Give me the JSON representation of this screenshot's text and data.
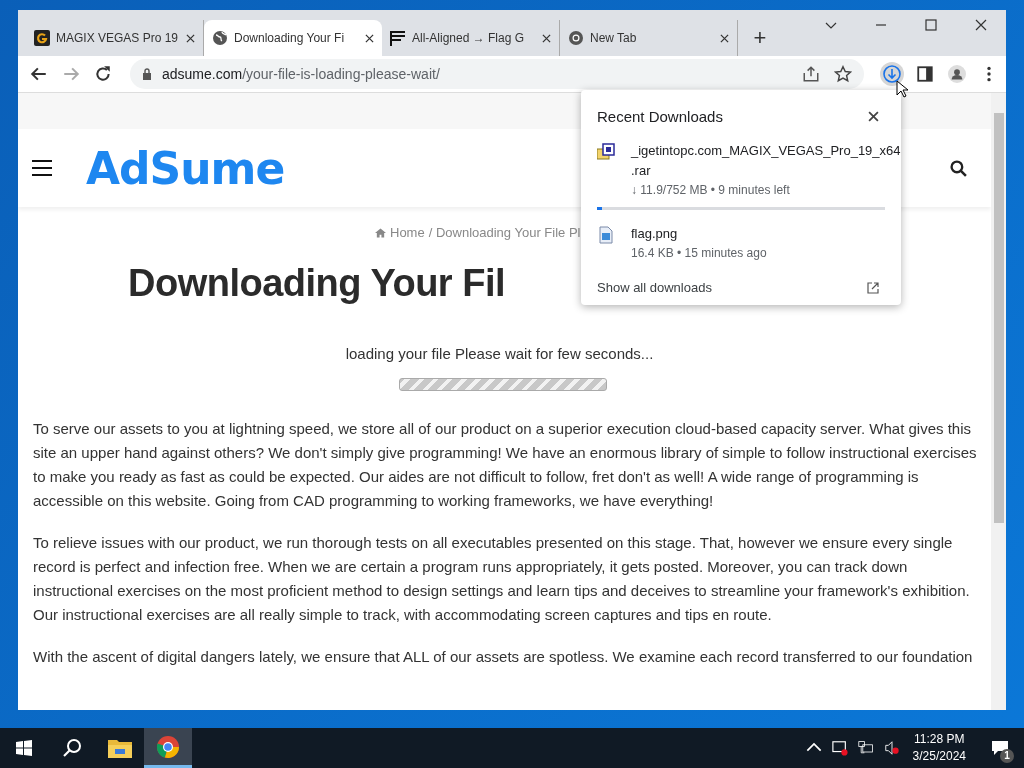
{
  "browser": {
    "tabs": [
      {
        "title": "MAGIX VEGAS Pro 19",
        "selected": false
      },
      {
        "title": "Downloading Your Fi",
        "selected": true
      },
      {
        "title": "All-Aligned → Flag G",
        "selected": false
      },
      {
        "title": "New Tab",
        "selected": false
      }
    ],
    "new_tab_button": "+",
    "address": {
      "domain": "adsume.com",
      "path": "/your-file-is-loading-please-wait/"
    }
  },
  "page": {
    "logo": "AdSume",
    "breadcrumb": {
      "home": "Home",
      "current": "/ Downloading Your File Pl"
    },
    "heading": "Downloading Your Fil",
    "loading_text": "loading your file Please wait for few seconds...",
    "paragraphs": [
      "To serve our assets to you at lightning speed, we store all of our product on a superior execution cloud-based capacity server. What gives this site an upper hand against others? We don't simply give programming! We have an enormous library of simple to follow instructional exercises to make you ready as fast as could be expected. Our aides are not difficult to follow, fret don't as well! A wide range of programming is accessible on this website. Going from CAD programming to working frameworks, we have everything!",
      "To relieve issues with our product, we run thorough tests on all executables presented on this stage. That, however we ensure every single record is perfect and infection free. When we are certain a program runs appropriately, it gets posted. Moreover, you can track down instructional exercises on the most proficient method to design settings and learn tips and deceives to streamline your framework's exhibition. Our instructional exercises are all really simple to track, with accommodating screen captures and tips en route.",
      "With the ascent of digital dangers lately, we ensure that ALL of our assets are spotless. We examine each record transferred to our foundation"
    ]
  },
  "downloads_popup": {
    "title": "Recent Downloads",
    "items": [
      {
        "kind": "progress",
        "name": "_igetintopc.com_MAGIX_VEGAS_Pro_19_x64\n.rar",
        "status": "↓ 11.9/752 MB • 9 minutes left",
        "level": 0.016
      },
      {
        "kind": "done",
        "name": "flag.png",
        "status": "16.4 KB • 15 minutes ago"
      }
    ],
    "show_all": "Show all downloads"
  },
  "taskbar": {
    "time": "11:28 PM",
    "date": "3/25/2024",
    "notifications": "1"
  }
}
